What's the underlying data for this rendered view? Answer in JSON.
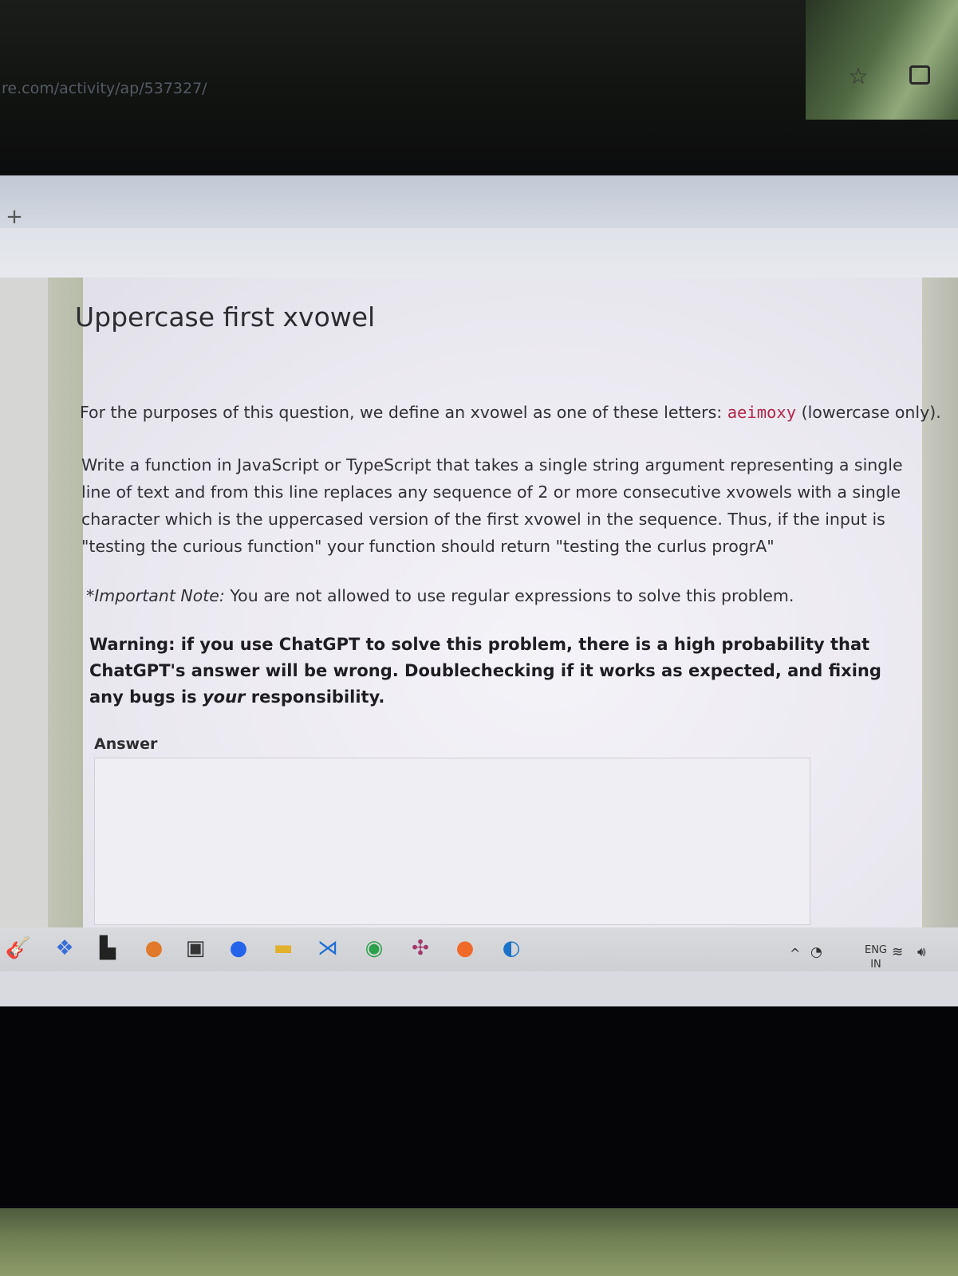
{
  "browser": {
    "url": "re.com/activity/ap/537327/"
  },
  "question": {
    "title": "Uppercase first xvowel",
    "intro_before": "For the purposes of this question, we define an xvowel as one of these letters: ",
    "intro_code": "aeimoxy",
    "intro_after": " (lowercase only).",
    "body": "Write a function in JavaScript or TypeScript that takes a single string argument representing a single line of text and from this line replaces any sequence of 2 or more consecutive xvowels with a single character which is the uppercased version of the first xvowel in the sequence. Thus, if the input is \"testing the curious function\" your function should return \"testing the curlus progrA\"",
    "note_label": "*Important Note:",
    "note_text": " You are not allowed to use regular expressions to solve this problem.",
    "warning_before": "Warning: if you use ChatGPT to solve this problem, there is a high probability that ChatGPT's answer will be wrong. Doublechecking if it works as expected, and fixing any bugs is ",
    "warning_em": "your",
    "warning_after": " responsibility.",
    "answer_label": "Answer"
  },
  "taskbar": {
    "icons": [
      "guitar-icon",
      "copilot-icon",
      "file-explorer-icon",
      "notification-app-icon",
      "terminal-icon",
      "zoom-icon",
      "folder-icon",
      "vscode-icon",
      "chrome-icon",
      "slack-icon",
      "postman-icon",
      "edge-icon"
    ],
    "tray_lang": "ENG",
    "tray_region": "IN"
  },
  "colors": {
    "code": "#b0264a",
    "taskbar": "#d9dadd"
  }
}
